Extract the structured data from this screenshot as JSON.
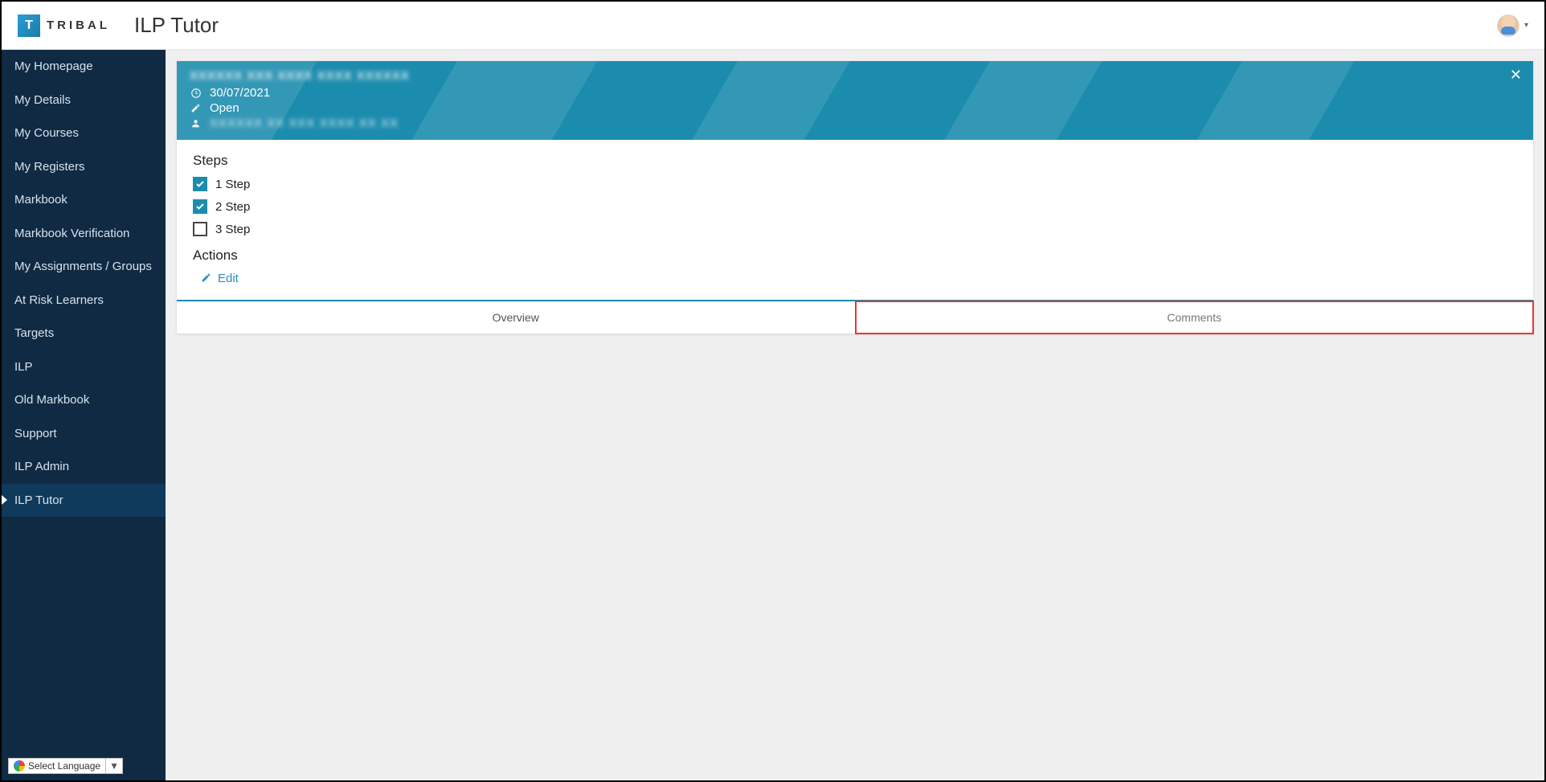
{
  "brand": {
    "mark": "T",
    "name": "TRIBAL"
  },
  "page_title": "ILP Tutor",
  "sidebar": {
    "items": [
      {
        "label": "My Homepage",
        "active": false
      },
      {
        "label": "My Details",
        "active": false
      },
      {
        "label": "My Courses",
        "active": false
      },
      {
        "label": "My Registers",
        "active": false
      },
      {
        "label": "Markbook",
        "active": false
      },
      {
        "label": "Markbook Verification",
        "active": false
      },
      {
        "label": "My Assignments / Groups",
        "active": false
      },
      {
        "label": "At Risk Learners",
        "active": false
      },
      {
        "label": "Targets",
        "active": false
      },
      {
        "label": "ILP",
        "active": false
      },
      {
        "label": "Old Markbook",
        "active": false
      },
      {
        "label": "Support",
        "active": false
      },
      {
        "label": "ILP Admin",
        "active": false
      },
      {
        "label": "ILP Tutor",
        "active": true
      }
    ]
  },
  "language_selector": {
    "label": "Select Language"
  },
  "record_header": {
    "title_blurred": "XXXXXX  XXX  XXXX XXXX  XXXXXX",
    "date": "30/07/2021",
    "status": "Open",
    "person_blurred": "XXXXXX  XX  XXX XXXX  XX  XX"
  },
  "steps": {
    "heading": "Steps",
    "items": [
      {
        "label": "1 Step",
        "checked": true
      },
      {
        "label": "2 Step",
        "checked": true
      },
      {
        "label": "3 Step",
        "checked": false
      }
    ]
  },
  "actions": {
    "heading": "Actions",
    "edit_label": "Edit"
  },
  "tabs": {
    "overview": "Overview",
    "comments": "Comments"
  }
}
